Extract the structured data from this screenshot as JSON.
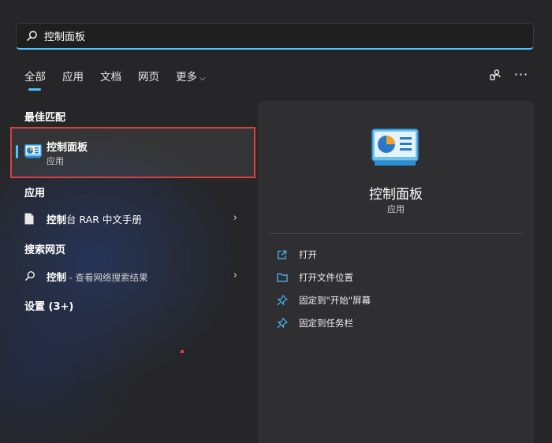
{
  "search": {
    "value": "控制面板"
  },
  "tabs": [
    {
      "label": "全部"
    },
    {
      "label": "应用"
    },
    {
      "label": "文档"
    },
    {
      "label": "网页"
    },
    {
      "label": "更多"
    }
  ],
  "left": {
    "best_match_title": "最佳匹配",
    "best_match": {
      "name": "控制面板",
      "type": "应用"
    },
    "apps_title": "应用",
    "apps": [
      {
        "bold": "控制",
        "rest": "台 RAR 中文手册"
      }
    ],
    "web_title": "搜索网页",
    "web": [
      {
        "bold": "控制",
        "rest": " - 查看网络搜索结果"
      }
    ],
    "settings_title": "设置 (3+)"
  },
  "panel": {
    "name": "控制面板",
    "type": "应用",
    "actions": [
      {
        "label": "打开",
        "icon": "open-external-icon"
      },
      {
        "label": "打开文件位置",
        "icon": "folder-icon"
      },
      {
        "label": "固定到\"开始\"屏幕",
        "icon": "pin-icon"
      },
      {
        "label": "固定到任务栏",
        "icon": "pin-icon"
      }
    ]
  },
  "colors": {
    "accent": "#4cc2ff",
    "highlight_border": "#d64141",
    "panel_bg": "#2f2f31"
  }
}
